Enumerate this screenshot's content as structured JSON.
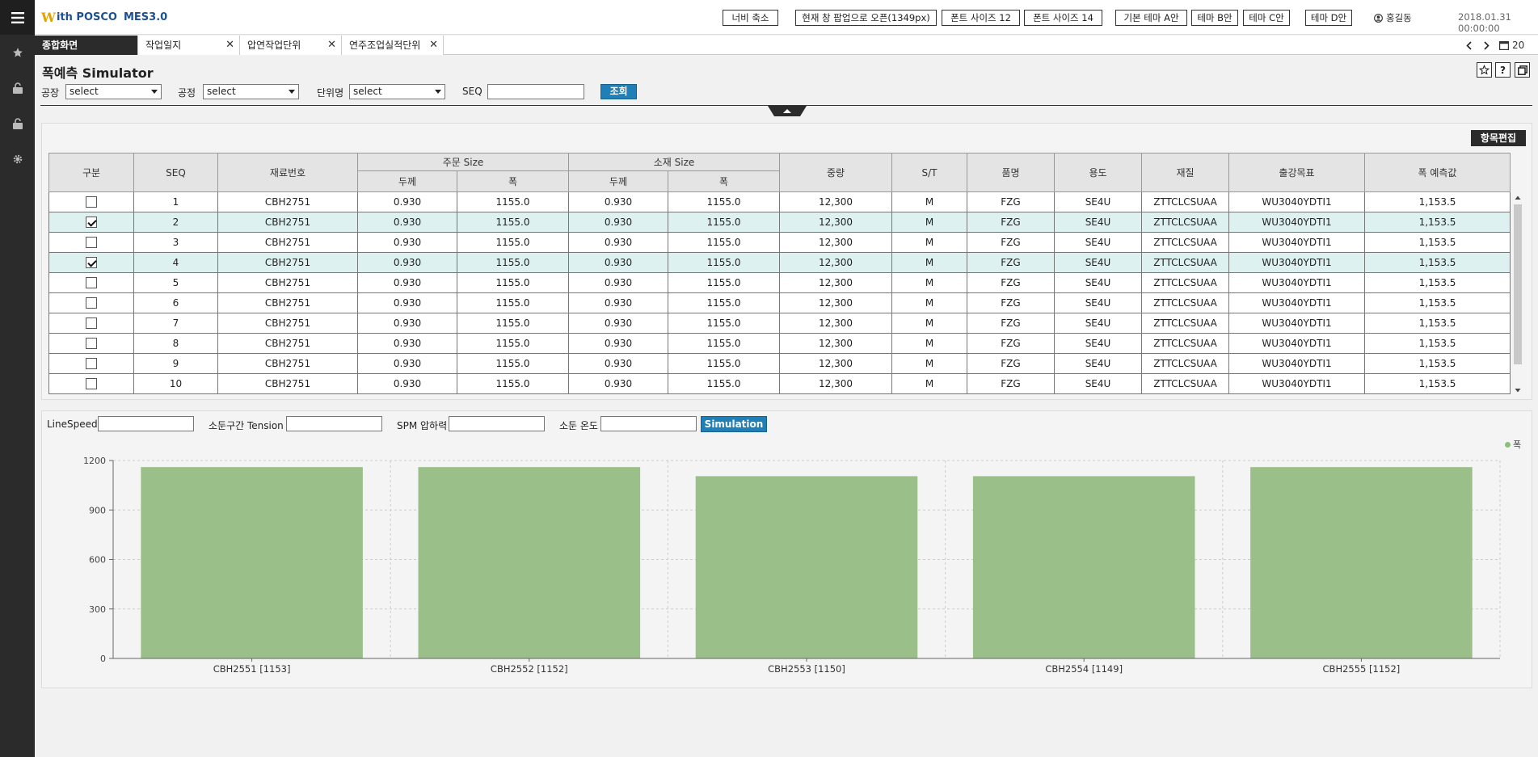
{
  "topbar": {
    "logo_w": "W",
    "logo_brand": "ith POSCO",
    "logo_mes": "MES3.0",
    "buttons": [
      "너비 축소",
      "현재 창 팝업으로 오픈(1349px)",
      "폰트 사이즈 12",
      "폰트 사이즈 14",
      "기본 테마 A안",
      "테마 B안",
      "테마 C안",
      "테마 D안"
    ],
    "user": "홍길동",
    "datetime": "2018.01.31 00:00:00"
  },
  "tabs": [
    {
      "label": "종합화면",
      "closable": false
    },
    {
      "label": "작업일지",
      "closable": true
    },
    {
      "label": "압연작업단위",
      "closable": true
    },
    {
      "label": "연주조업실적단위",
      "closable": true
    }
  ],
  "tabnav": {
    "count": "20"
  },
  "page": {
    "title": "폭예측 Simulator"
  },
  "filters": {
    "factory_label": "공장",
    "factory_value": "select",
    "process_label": "공정",
    "process_value": "select",
    "unit_label": "단위명",
    "unit_value": "select",
    "seq_label": "SEQ",
    "seq_value": "",
    "search_label": "조회"
  },
  "grid": {
    "edit_label": "항목편집",
    "headers": {
      "div": "구분",
      "seq": "SEQ",
      "material": "재료번호",
      "order_size": "주문 Size",
      "material_size": "소재 Size",
      "thickness": "두께",
      "width": "폭",
      "weight": "중량",
      "st": "S/T",
      "product": "품명",
      "usage": "용도",
      "quality": "재질",
      "target": "출강목표",
      "predict": "폭 예측값"
    },
    "rows": [
      {
        "checked": false,
        "seq": "1",
        "material": "CBH2751",
        "ot": "0.930",
        "ow": "1155.0",
        "mt": "0.930",
        "mw": "1155.0",
        "weight": "12,300",
        "st": "M",
        "product": "FZG",
        "usage": "SE4U",
        "quality": "ZTTCLCSUAA",
        "target": "WU3040YDTI1",
        "predict": "1,153.5"
      },
      {
        "checked": true,
        "seq": "2",
        "material": "CBH2751",
        "ot": "0.930",
        "ow": "1155.0",
        "mt": "0.930",
        "mw": "1155.0",
        "weight": "12,300",
        "st": "M",
        "product": "FZG",
        "usage": "SE4U",
        "quality": "ZTTCLCSUAA",
        "target": "WU3040YDTI1",
        "predict": "1,153.5"
      },
      {
        "checked": false,
        "seq": "3",
        "material": "CBH2751",
        "ot": "0.930",
        "ow": "1155.0",
        "mt": "0.930",
        "mw": "1155.0",
        "weight": "12,300",
        "st": "M",
        "product": "FZG",
        "usage": "SE4U",
        "quality": "ZTTCLCSUAA",
        "target": "WU3040YDTI1",
        "predict": "1,153.5"
      },
      {
        "checked": true,
        "seq": "4",
        "material": "CBH2751",
        "ot": "0.930",
        "ow": "1155.0",
        "mt": "0.930",
        "mw": "1155.0",
        "weight": "12,300",
        "st": "M",
        "product": "FZG",
        "usage": "SE4U",
        "quality": "ZTTCLCSUAA",
        "target": "WU3040YDTI1",
        "predict": "1,153.5"
      },
      {
        "checked": false,
        "seq": "5",
        "material": "CBH2751",
        "ot": "0.930",
        "ow": "1155.0",
        "mt": "0.930",
        "mw": "1155.0",
        "weight": "12,300",
        "st": "M",
        "product": "FZG",
        "usage": "SE4U",
        "quality": "ZTTCLCSUAA",
        "target": "WU3040YDTI1",
        "predict": "1,153.5"
      },
      {
        "checked": false,
        "seq": "6",
        "material": "CBH2751",
        "ot": "0.930",
        "ow": "1155.0",
        "mt": "0.930",
        "mw": "1155.0",
        "weight": "12,300",
        "st": "M",
        "product": "FZG",
        "usage": "SE4U",
        "quality": "ZTTCLCSUAA",
        "target": "WU3040YDTI1",
        "predict": "1,153.5"
      },
      {
        "checked": false,
        "seq": "7",
        "material": "CBH2751",
        "ot": "0.930",
        "ow": "1155.0",
        "mt": "0.930",
        "mw": "1155.0",
        "weight": "12,300",
        "st": "M",
        "product": "FZG",
        "usage": "SE4U",
        "quality": "ZTTCLCSUAA",
        "target": "WU3040YDTI1",
        "predict": "1,153.5"
      },
      {
        "checked": false,
        "seq": "8",
        "material": "CBH2751",
        "ot": "0.930",
        "ow": "1155.0",
        "mt": "0.930",
        "mw": "1155.0",
        "weight": "12,300",
        "st": "M",
        "product": "FZG",
        "usage": "SE4U",
        "quality": "ZTTCLCSUAA",
        "target": "WU3040YDTI1",
        "predict": "1,153.5"
      },
      {
        "checked": false,
        "seq": "9",
        "material": "CBH2751",
        "ot": "0.930",
        "ow": "1155.0",
        "mt": "0.930",
        "mw": "1155.0",
        "weight": "12,300",
        "st": "M",
        "product": "FZG",
        "usage": "SE4U",
        "quality": "ZTTCLCSUAA",
        "target": "WU3040YDTI1",
        "predict": "1,153.5"
      },
      {
        "checked": false,
        "seq": "10",
        "material": "CBH2751",
        "ot": "0.930",
        "ow": "1155.0",
        "mt": "0.930",
        "mw": "1155.0",
        "weight": "12,300",
        "st": "M",
        "product": "FZG",
        "usage": "SE4U",
        "quality": "ZTTCLCSUAA",
        "target": "WU3040YDTI1",
        "predict": "1,153.5"
      }
    ]
  },
  "simulation": {
    "linespeed_label": "LineSpeed",
    "tension_label": "소둔구간 Tension",
    "spm_label": "SPM 압하력",
    "temp_label": "소둔 온도",
    "button_label": "Simulation"
  },
  "colors": {
    "accent": "#1f7fb6",
    "bar": "#9bbf88",
    "selected_row": "#ddf1f1",
    "sidebar": "#2b2b2b"
  },
  "chart_data": {
    "type": "bar",
    "categories": [
      "CBH2551 [1153]",
      "CBH2552 [1152]",
      "CBH2553 [1150]",
      "CBH2554 [1149]",
      "CBH2555 [1152]"
    ],
    "series": [
      {
        "name": "폭",
        "values": [
          1160,
          1160,
          1105,
          1105,
          1160
        ]
      }
    ],
    "yticks": [
      "0",
      "300",
      "600",
      "900",
      "1200"
    ],
    "ylim": [
      0,
      1200
    ],
    "grid": true,
    "legend": "top-right",
    "title": "",
    "xlabel": "",
    "ylabel": ""
  }
}
